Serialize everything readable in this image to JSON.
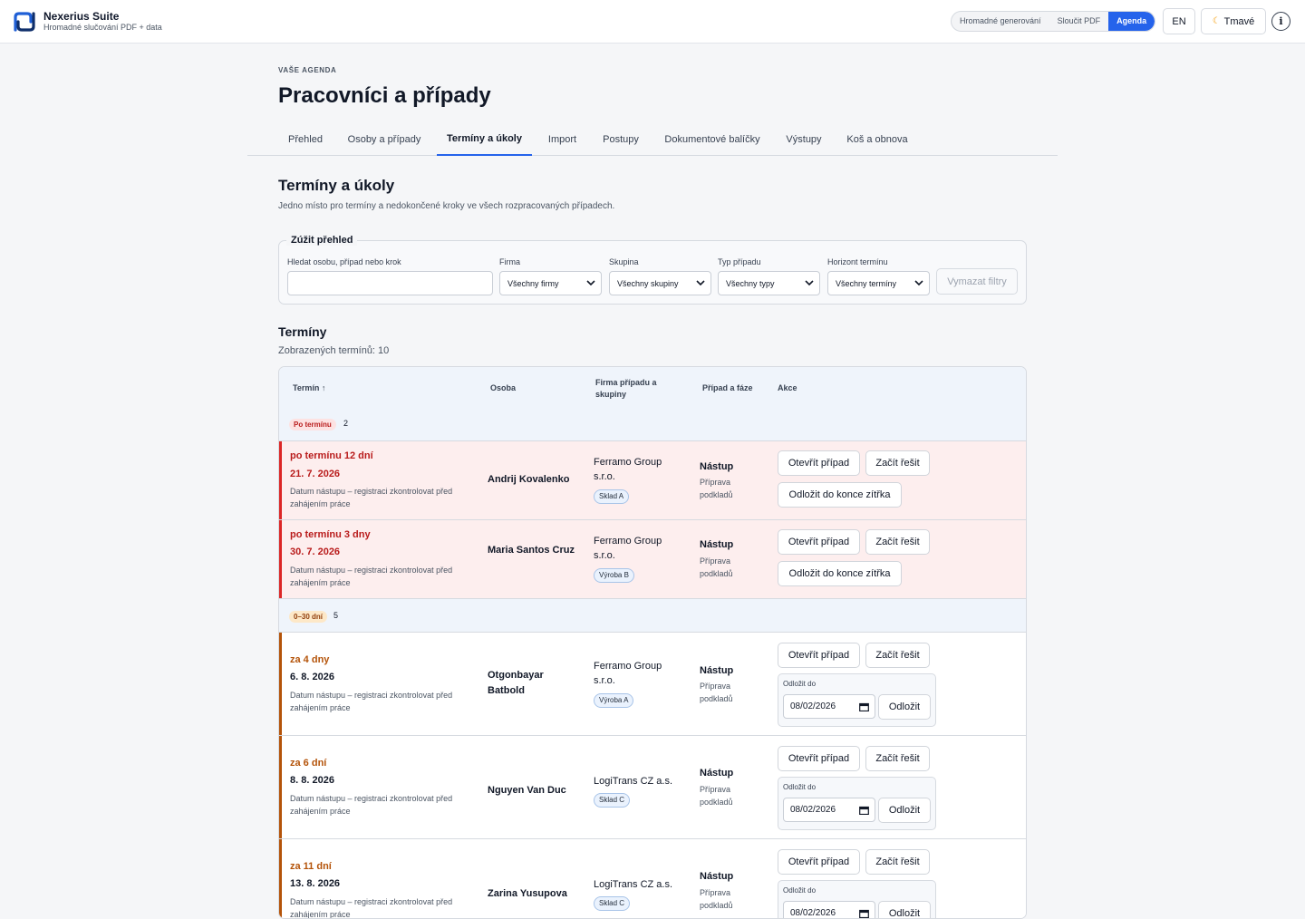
{
  "app": {
    "name": "Nexerius Suite",
    "subtitle": "Hromadné slučování PDF + data"
  },
  "modes": [
    "Hromadné generování",
    "Sloučit PDF",
    "Agenda"
  ],
  "active_mode": "Agenda",
  "header_actions": {
    "lang": "EN",
    "theme": "Tmavé",
    "theme_icon": "moon-icon",
    "info_icon": "info-icon"
  },
  "eyebrow": "VAŠE AGENDA",
  "page_title": "Pracovníci a případy",
  "tabs": [
    "Přehled",
    "Osoby a případy",
    "Termíny a úkoly",
    "Import",
    "Postupy",
    "Dokumentové balíčky",
    "Výstupy",
    "Koš a obnova"
  ],
  "active_tab": "Termíny a úkoly",
  "section": {
    "title": "Termíny a úkoly",
    "description": "Jedno místo pro termíny a nedokončené kroky ve všech rozpracovaných případech."
  },
  "filters": {
    "legend": "Zúžit přehled",
    "search_label": "Hledat osobu, případ nebo krok",
    "search_value": "",
    "firm_label": "Firma",
    "firm_value": "Všechny firmy",
    "group_label": "Skupina",
    "group_value": "Všechny skupiny",
    "type_label": "Typ případu",
    "type_value": "Všechny typy",
    "horizon_label": "Horizont termínu",
    "horizon_value": "Všechny termíny",
    "clear_label": "Vymazat filtry"
  },
  "deadlines": {
    "title": "Termíny",
    "count_text": "Zobrazených termínů: 10",
    "columns": [
      "Termín ↑",
      "Osoba",
      "Firma případu a skupiny",
      "Případ a fáze",
      "Akce"
    ],
    "groups": [
      {
        "label": "Po termínu",
        "count": "2",
        "color": "#dc2626",
        "rows": [
          {
            "relative": "po termínu 12 dní",
            "date": "21. 7. 2026",
            "note": "Datum nástupu – registraci zkontrolovat před zahájením práce",
            "person": "Andrij Kovalenko",
            "firm": "Ferramo Group s.r.o.",
            "group": "Sklad A",
            "case": "Nástup",
            "phase": "Příprava podkladů",
            "actions": [
              "Otevřít případ",
              "Začít řešit",
              "Odložit do konce zítřka"
            ]
          },
          {
            "relative": "po termínu 3 dny",
            "date": "30. 7. 2026",
            "note": "Datum nástupu – registraci zkontrolovat před zahájením práce",
            "person": "Maria Santos Cruz",
            "firm": "Ferramo Group s.r.o.",
            "group": "Výroba B",
            "case": "Nástup",
            "phase": "Příprava podkladů",
            "actions": [
              "Otevřít případ",
              "Začít řešit",
              "Odložit do konce zítřka"
            ]
          }
        ]
      },
      {
        "label": "0–30 dní",
        "count": "5",
        "color": "#b45309",
        "rows": [
          {
            "relative": "za 4 dny",
            "date": "6. 8. 2026",
            "note": "Datum nástupu – registraci zkontrolovat před zahájením práce",
            "person": "Otgonbayar Batbold",
            "firm": "Ferramo Group s.r.o.",
            "group": "Výroba A",
            "case": "Nástup",
            "phase": "Příprava podkladů",
            "actions": [
              "Otevřít případ",
              "Začít řešit"
            ],
            "postpone_label": "Odložit do",
            "postpone_date": "08/02/2026",
            "postpone_button": "Odložit"
          },
          {
            "relative": "za 6 dní",
            "date": "8. 8. 2026",
            "note": "Datum nástupu – registraci zkontrolovat před zahájením práce",
            "person": "Nguyen Van Duc",
            "firm": "LogiTrans CZ a.s.",
            "group": "Sklad C",
            "case": "Nástup",
            "phase": "Příprava podkladů",
            "actions": [
              "Otevřít případ",
              "Začít řešit"
            ],
            "postpone_label": "Odložit do",
            "postpone_date": "08/02/2026",
            "postpone_button": "Odložit"
          },
          {
            "relative": "za 11 dní",
            "date": "13. 8. 2026",
            "note": "Datum nástupu – registraci zkontrolovat před zahájením práce",
            "person": "Zarina Yusupova",
            "firm": "LogiTrans CZ a.s.",
            "group": "Sklad C",
            "case": "Nástup",
            "phase": "Příprava podkladů",
            "actions": [
              "Otevřít případ",
              "Začít řešit"
            ],
            "postpone_label": "Odložit do",
            "postpone_date": "08/02/2026",
            "postpone_button": "Odložit"
          }
        ]
      }
    ]
  },
  "colors": {
    "accent": "#2563eb",
    "overdue": "#dc2626",
    "soon": "#b45309"
  }
}
